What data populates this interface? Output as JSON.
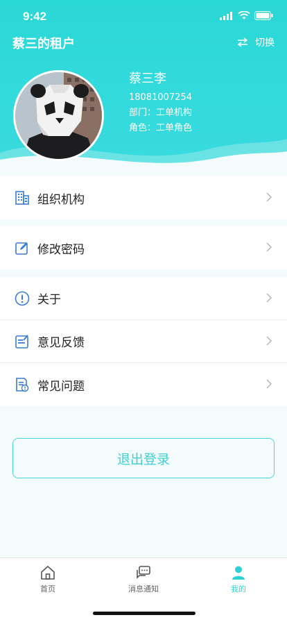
{
  "status_bar": {
    "time": "9:42"
  },
  "header": {
    "title": "蔡三的租户",
    "switch_label": "切换"
  },
  "user": {
    "name": "蔡三李",
    "phone": "18081007254",
    "department": "部门：工单机构",
    "role": "角色：工单角色"
  },
  "menu": {
    "org": "组织机构",
    "password": "修改密码",
    "about": "关于",
    "feedback": "意见反馈",
    "faq": "常见问题"
  },
  "logout_label": "退出登录",
  "tabs": [
    {
      "label": "首页",
      "icon": "home-icon",
      "active": false
    },
    {
      "label": "消息通知",
      "icon": "message-icon",
      "active": false
    },
    {
      "label": "我的",
      "icon": "profile-icon",
      "active": true
    }
  ],
  "colors": {
    "accent": "#2fd0d3",
    "header_bg": "#2ad8d6",
    "icon_blue": "#3a7bd5"
  }
}
